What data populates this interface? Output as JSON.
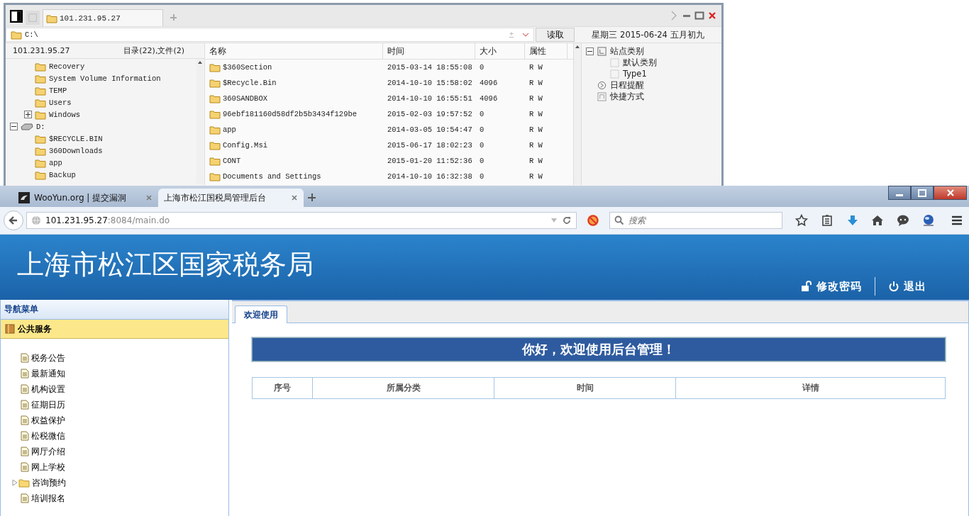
{
  "file_manager": {
    "tabs": [
      {
        "label": "101.231.95.27",
        "selected": true
      }
    ],
    "path": "C:\\",
    "read_button": "读取",
    "date": "星期三 2015-06-24 五月初九",
    "tree_header": {
      "host": "101.231.95.27",
      "summary": "目录(22),文件(2)"
    },
    "tree": [
      {
        "kind": "continued",
        "children": [
          {
            "label": "Recovery"
          },
          {
            "label": "System Volume Information"
          },
          {
            "label": "TEMP"
          },
          {
            "label": "Users"
          },
          {
            "label": "Windows",
            "expanded": false
          }
        ]
      },
      {
        "kind": "drive",
        "label": "D:",
        "expanded": true,
        "children": [
          {
            "label": "$RECYCLE.BIN"
          },
          {
            "label": "360Downloads"
          },
          {
            "label": "app"
          },
          {
            "label": "Backup"
          }
        ]
      }
    ],
    "columns": [
      "名称",
      "时间",
      "大小",
      "属性"
    ],
    "rows": [
      [
        "$360Section",
        "2015-03-14 18:55:08",
        "0",
        "R W"
      ],
      [
        "$Recycle.Bin",
        "2014-10-10 15:58:02",
        "4096",
        "R W"
      ],
      [
        "360SANDBOX",
        "2014-10-10 16:55:51",
        "4096",
        "R W"
      ],
      [
        "96ebf181160d58df2b5b3434f129be",
        "2015-02-03 19:57:52",
        "0",
        "R W"
      ],
      [
        "app",
        "2014-03-05 10:54:47",
        "0",
        "R W"
      ],
      [
        "Config.Msi",
        "2015-06-17 18:02:23",
        "0",
        "R W"
      ],
      [
        "CONT",
        "2015-01-20 11:52:36",
        "0",
        "R W"
      ],
      [
        "Documents and Settings",
        "2014-10-10 16:32:38",
        "0",
        "R W"
      ]
    ],
    "side_tree": [
      {
        "kind": "category",
        "label": "站点类别",
        "expanded": true,
        "children": [
          {
            "kind": "item",
            "label": "默认类别"
          },
          {
            "kind": "item",
            "label": "Type1"
          }
        ]
      },
      {
        "kind": "schedule",
        "label": "日程提醒"
      },
      {
        "kind": "shortcut",
        "label": "快捷方式"
      }
    ]
  },
  "browser": {
    "tabs": [
      {
        "label": "WooYun.org | 提交漏洞",
        "selected": false
      },
      {
        "label": "上海市松江国税局管理后台",
        "selected": true
      }
    ],
    "url": {
      "host": "101.231.95.27",
      "rest": ":8084/main.do"
    },
    "search": {
      "placeholder": "搜索"
    }
  },
  "page": {
    "title": "上海市松江区国家税务局",
    "actions": [
      {
        "kind": "password",
        "label": "修改密码"
      },
      {
        "kind": "logout",
        "label": "退出"
      }
    ],
    "nav_title": "导航菜单",
    "section": "公共服务",
    "menu": [
      {
        "kind": "page",
        "label": "税务公告"
      },
      {
        "kind": "page",
        "label": "最新通知"
      },
      {
        "kind": "page",
        "label": "机构设置"
      },
      {
        "kind": "page",
        "label": "征期日历"
      },
      {
        "kind": "page",
        "label": "权益保护"
      },
      {
        "kind": "page",
        "label": "松税微信"
      },
      {
        "kind": "page",
        "label": "网厅介绍"
      },
      {
        "kind": "page",
        "label": "网上学校"
      },
      {
        "kind": "folder",
        "label": "咨询预约",
        "expanded": false
      },
      {
        "kind": "page",
        "label": "培训报名"
      }
    ],
    "tabs": [
      {
        "label": "欢迎使用",
        "selected": true
      }
    ],
    "banner": "你好，欢迎使用后台管理！",
    "table_columns": [
      "序号",
      "所属分类",
      "时间",
      "详情"
    ]
  }
}
